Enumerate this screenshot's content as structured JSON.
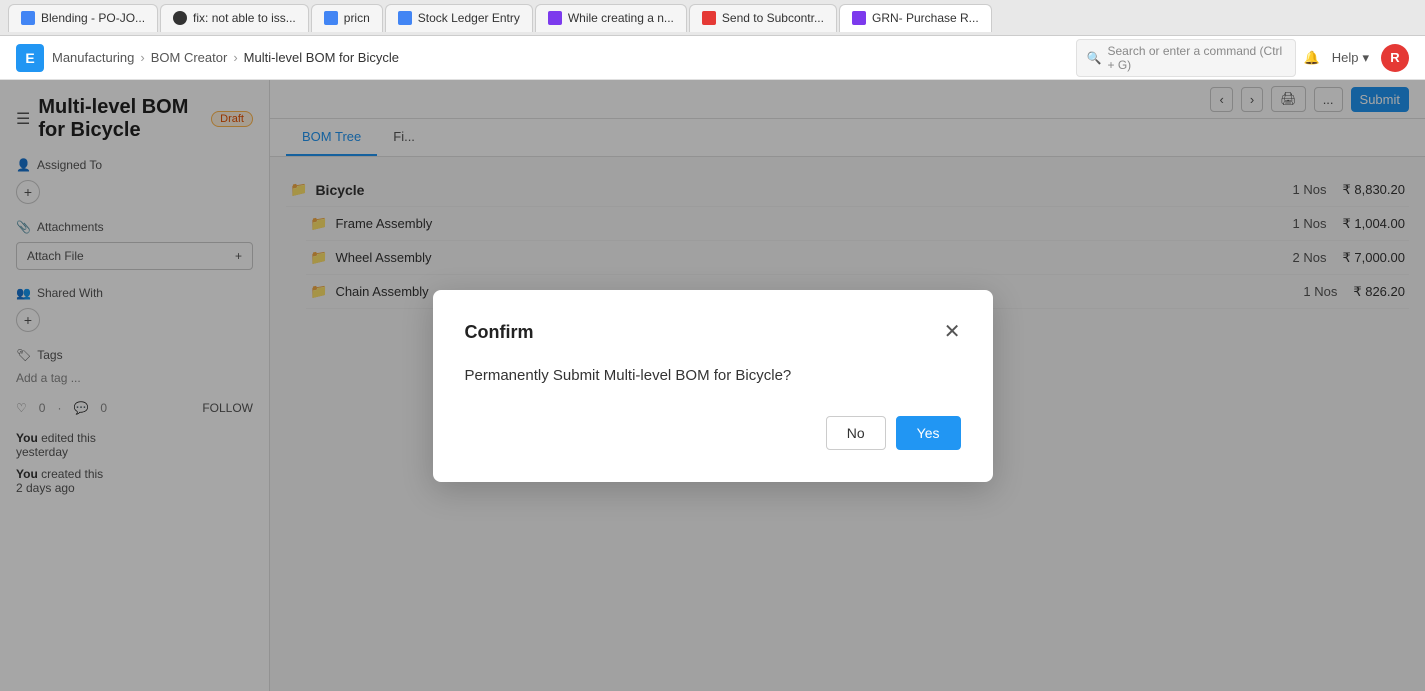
{
  "browser": {
    "tabs": [
      {
        "id": "tab1",
        "label": "Blending - PO-JO...",
        "icon_type": "blue",
        "icon_text": "E",
        "active": false
      },
      {
        "id": "tab2",
        "label": "fix: not able to iss...",
        "icon_type": "dark",
        "icon_text": "G",
        "active": false
      },
      {
        "id": "tab3",
        "label": "pricn",
        "icon_type": "blue",
        "icon_text": "E",
        "active": false
      },
      {
        "id": "tab4",
        "label": "Stock Ledger Entry",
        "icon_type": "blue",
        "icon_text": "E",
        "active": false
      },
      {
        "id": "tab5",
        "label": "While creating a n...",
        "icon_type": "purple",
        "icon_text": "F",
        "active": false
      },
      {
        "id": "tab6",
        "label": "Send to Subcontr...",
        "icon_type": "red",
        "icon_text": "S",
        "active": false
      },
      {
        "id": "tab7",
        "label": "GRN- Purchase R...",
        "icon_type": "purple",
        "icon_text": "F",
        "active": true
      }
    ]
  },
  "header": {
    "logo_text": "E",
    "breadcrumbs": [
      "Manufacturing",
      "BOM Creator",
      "Multi-level BOM for Bicycle"
    ],
    "search_placeholder": "Search or enter a command (Ctrl + G)",
    "help_label": "Help",
    "avatar_text": "R"
  },
  "doc": {
    "title": "Multi-level BOM for Bicycle",
    "status": "Draft",
    "menu_icon": "☰"
  },
  "sidebar": {
    "assigned_to_label": "Assigned To",
    "attachments_label": "Attachments",
    "attach_file_label": "Attach File",
    "shared_with_label": "Shared With",
    "tags_label": "Tags",
    "add_tag_label": "Add a tag ...",
    "likes_count": "0",
    "comments_count": "0",
    "follow_label": "FOLLOW",
    "activity": [
      {
        "actor": "You",
        "action": "edited this",
        "time": "yesterday"
      },
      {
        "actor": "You",
        "action": "created this",
        "time": "2 days ago"
      }
    ]
  },
  "toolbar": {
    "prev_label": "‹",
    "next_label": "›",
    "print_label": "⊞",
    "more_label": "...",
    "submit_label": "Submit"
  },
  "tabs": [
    {
      "id": "bom-tree",
      "label": "BOM Tree",
      "active": true
    },
    {
      "id": "finance",
      "label": "Fi...",
      "active": false
    }
  ],
  "bom_tree": {
    "root": {
      "name": "Bicycle",
      "qty": "1 Nos",
      "price": "₹ 8,830.20"
    },
    "items": [
      {
        "name": "Frame Assembly",
        "qty": "1 Nos",
        "price": "₹ 1,004.00"
      },
      {
        "name": "Wheel Assembly",
        "qty": "2 Nos",
        "price": "₹ 7,000.00"
      },
      {
        "name": "Chain Assembly",
        "qty": "1 Nos",
        "price": "₹ 826.20"
      }
    ]
  },
  "modal": {
    "title": "Confirm",
    "message": "Permanently Submit Multi-level BOM for Bicycle?",
    "no_label": "No",
    "yes_label": "Yes"
  }
}
